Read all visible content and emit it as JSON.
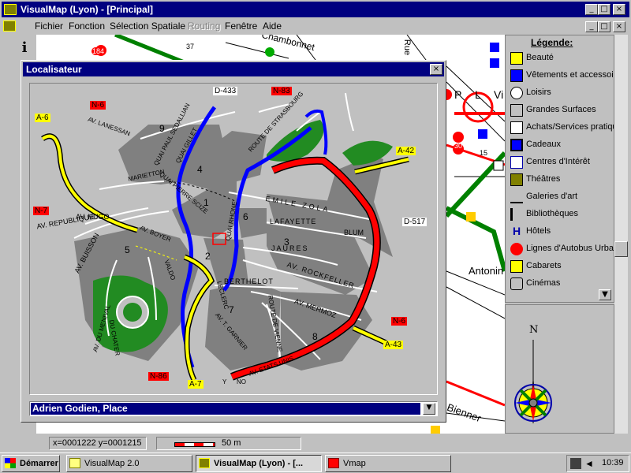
{
  "app": {
    "title": "VisualMap  (Lyon) - [Principal]",
    "menu": [
      "Fichier",
      "Fonction",
      "Sélection Spatiale",
      "Routing",
      "Fenêtre",
      "Aide"
    ],
    "menu_disabled": [
      false,
      false,
      false,
      true,
      false,
      false
    ],
    "title_buttons": [
      "_",
      "□",
      "×"
    ]
  },
  "background_map": {
    "streets": [
      "Chambonnet",
      "Antonin",
      "Bienner",
      "Rue",
      "P",
      "L",
      "Vi"
    ],
    "markers": [
      "37",
      "184",
      "15",
      "30"
    ]
  },
  "legend": {
    "title": "Légende:",
    "items": [
      {
        "label": "Beauté",
        "icon": "beauty-icon"
      },
      {
        "label": "Vêtements et accessoires",
        "icon": "clothing-icon"
      },
      {
        "label": "Loisirs",
        "icon": "leisure-icon"
      },
      {
        "label": "Grandes Surfaces",
        "icon": "supermarket-icon"
      },
      {
        "label": "Achats/Services pratiques",
        "icon": "shopping-icon"
      },
      {
        "label": "Cadeaux",
        "icon": "gift-icon"
      },
      {
        "label": "Centres d'Intérêt",
        "icon": "interest-icon"
      },
      {
        "label": "Théâtres",
        "icon": "theatre-icon"
      },
      {
        "label": "Galeries d'art",
        "icon": "gallery-icon"
      },
      {
        "label": "Bibliothèques",
        "icon": "library-icon"
      },
      {
        "label": "Hôtels",
        "icon": "hotel-icon"
      },
      {
        "label": "Lignes d'Autobus Urbain",
        "icon": "bus-icon"
      },
      {
        "label": "Cabarets",
        "icon": "cabaret-icon"
      },
      {
        "label": "Cinémas",
        "icon": "cinema-icon"
      }
    ],
    "compass_north": "N"
  },
  "localisateur": {
    "title": "Localisateur",
    "close": "×",
    "selected_place": "Adrien Godien, Place",
    "dropdown_arrow": "▼",
    "roads": {
      "a6": "A-6",
      "a42": "A-42",
      "a43": "A-43",
      "a7": "A-7",
      "d433": "D-433",
      "d517": "D-517",
      "n83": "N-83",
      "n6a": "N-6",
      "n7": "N-7",
      "n6b": "N-6",
      "n86": "N-86"
    },
    "districts": [
      "9",
      "4",
      "1",
      "6",
      "3",
      "2",
      "5",
      "7",
      "8"
    ],
    "streets": {
      "lanessan": "AV. LANESSAN",
      "paul_sedaillan": "QUAI PAUL SEDALLIAN",
      "gillet": "QUAI GILLET",
      "strasbourg": "ROUTE DE STRASBOURG",
      "marietton": "MARIETTON",
      "pierre_scize": "QUAI PIERRE SCIZE",
      "emile_zola": "EMILE ZOLA",
      "lafayette": "LAFAYETTE",
      "blum": "BLUM",
      "jaures": "JAURES",
      "rockfeller": "AV. ROCKFELLER",
      "berthelot": "BERTHELOT",
      "mermoz": "AV. MERMOZ",
      "etats_unis": "AV. ETATS UNIS",
      "vienne": "ROUTE DE VIENNE",
      "garnier": "AV. T. GARNIER",
      "republique": "AV. REPUBLIQUE",
      "hugo": "AV. HUGO",
      "buisson": "AV. BUISSON",
      "menival": "AV. DU MENIVAL",
      "chater": "DU CHATER",
      "boyer": "AV. BOYER",
      "valdo": "VALDO",
      "quai_rhone": "QUAI RHONE",
      "lecler": "LECLERC",
      "y": "Y",
      "no": "NO"
    }
  },
  "status": {
    "coords": "x=0001222 y=0001215",
    "scale": "50 m"
  },
  "taskbar": {
    "start": "Démarrer",
    "tasks": [
      "VisualMap 2.0",
      "VisualMap  (Lyon) - [...",
      "Vmap"
    ],
    "clock": "10:39"
  },
  "colors": {
    "titlebar": "#000080",
    "legend_panel": "#c0c0c0",
    "blue_river": "#0000ff",
    "red_ring": "#ff0000",
    "yellow_highway": "#ffff00",
    "park_green": "#228b22",
    "district_gray": "#808080"
  }
}
